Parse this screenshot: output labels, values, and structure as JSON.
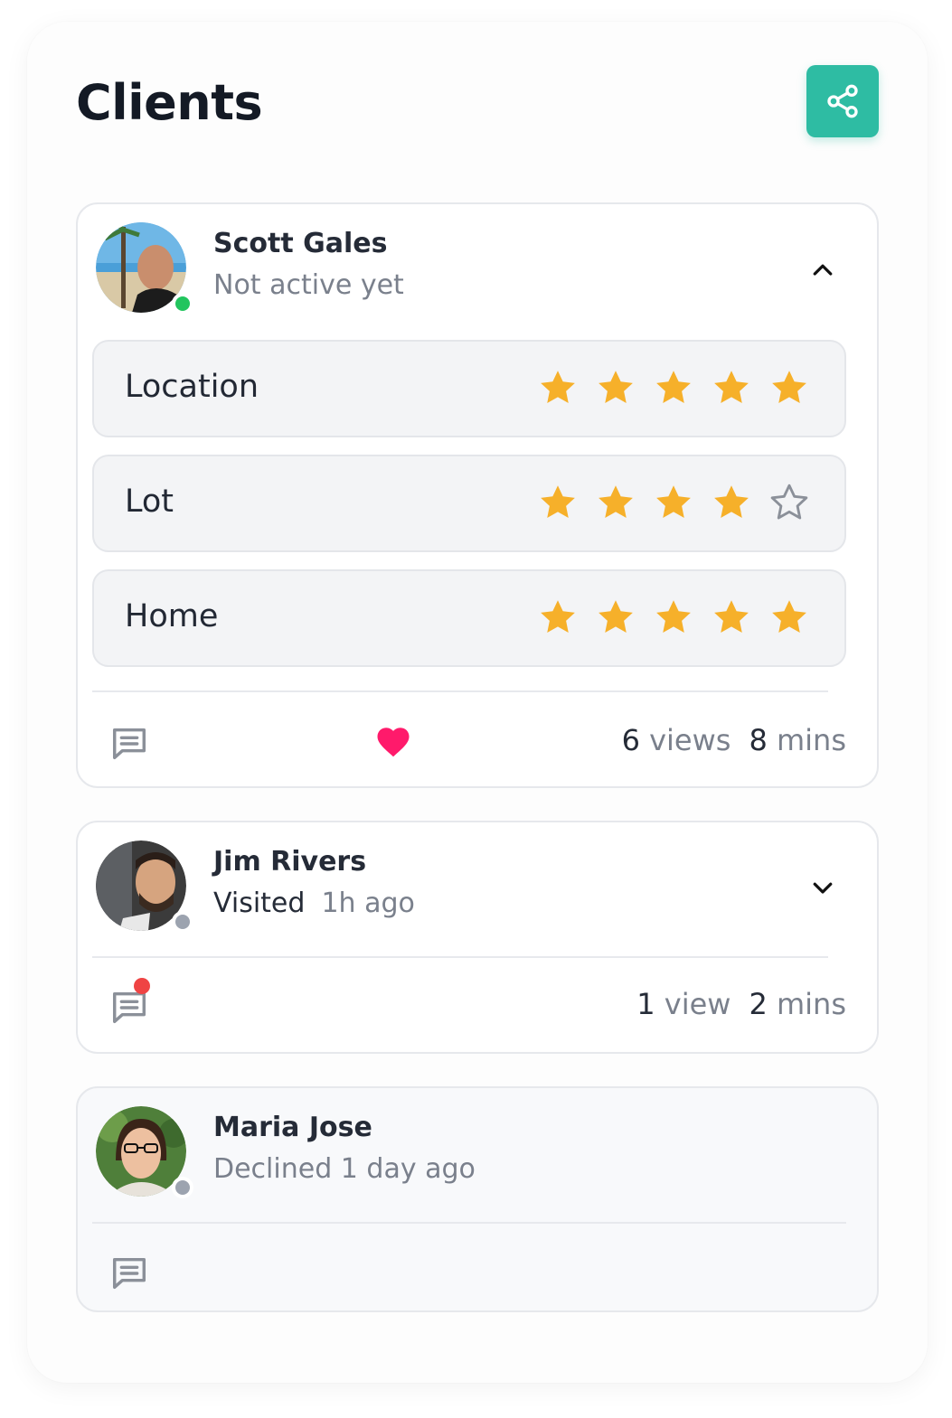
{
  "header": {
    "title": "Clients",
    "share_icon": "share-icon"
  },
  "colors": {
    "accent": "#2ebca3",
    "star": "#f6b02a",
    "heart": "#ff1a6b",
    "online": "#22c55e",
    "offline": "#9ca3af",
    "badge": "#ef4444"
  },
  "clients": [
    {
      "name": "Scott Gales",
      "status": "Not active yet",
      "presence": "online",
      "expanded": true,
      "ratings": [
        {
          "label": "Location",
          "stars": 5,
          "max": 5
        },
        {
          "label": "Lot",
          "stars": 4,
          "max": 5
        },
        {
          "label": "Home",
          "stars": 5,
          "max": 5
        }
      ],
      "liked": true,
      "views_num": "6",
      "views_unit": "views",
      "mins_num": "8",
      "mins_unit": "mins"
    },
    {
      "name": "Jim Rivers",
      "status_prefix": "Visited",
      "status_time": "1h ago",
      "presence": "offline",
      "expanded": false,
      "unread": true,
      "views_num": "1",
      "views_unit": "view",
      "mins_num": "2",
      "mins_unit": "mins"
    },
    {
      "name": "Maria Jose",
      "status": "Declined 1 day ago",
      "presence": "offline"
    }
  ]
}
